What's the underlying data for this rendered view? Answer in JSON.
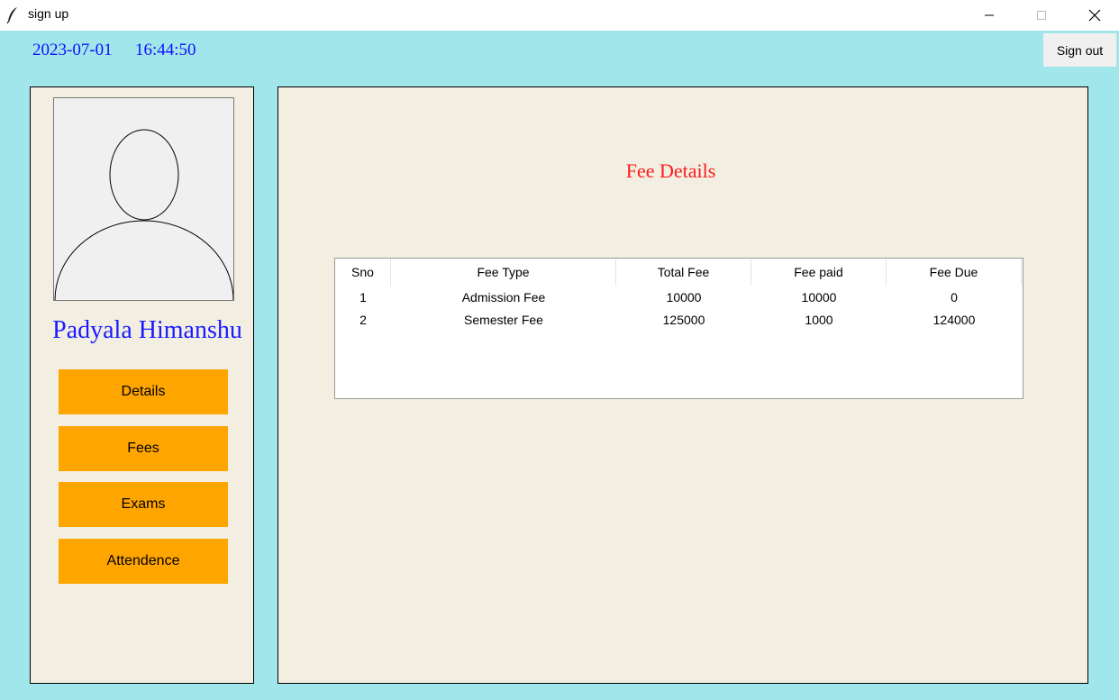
{
  "window": {
    "title": "sign up",
    "icon": "feather-icon"
  },
  "header": {
    "date": "2023-07-01",
    "time": "16:44:50",
    "signout_label": "Sign out"
  },
  "sidebar": {
    "user_name": "Padyala Himanshu",
    "avatar_icon": "user-silhouette-icon",
    "buttons": [
      {
        "label": "Details"
      },
      {
        "label": "Fees"
      },
      {
        "label": "Exams"
      },
      {
        "label": "Attendence"
      }
    ]
  },
  "main": {
    "title": "Fee Details",
    "table": {
      "headers": [
        "Sno",
        "Fee Type",
        "Total Fee",
        "Fee paid",
        "Fee Due"
      ],
      "rows": [
        [
          "1",
          "Admission Fee",
          "10000",
          "10000",
          "0"
        ],
        [
          "2",
          "Semester Fee",
          "125000",
          "1000",
          "124000"
        ]
      ]
    }
  },
  "colors": {
    "background": "#a0e6ea",
    "panel": "#f2efe2",
    "button": "#ffa500",
    "title_red": "#ff1a1a",
    "name_blue": "#1a1aff"
  }
}
